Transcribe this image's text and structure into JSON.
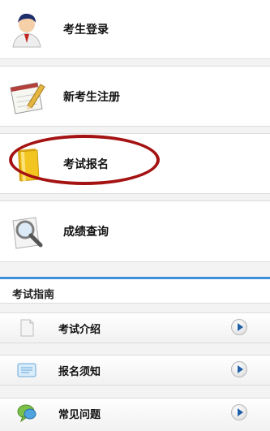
{
  "menu": {
    "items": [
      {
        "label": "考生登录",
        "icon": "user-avatar-icon"
      },
      {
        "label": "新考生注册",
        "icon": "notepad-pencil-icon"
      },
      {
        "label": "考试报名",
        "icon": "folder-icon"
      },
      {
        "label": "成绩查询",
        "icon": "magnifier-icon"
      }
    ]
  },
  "guide": {
    "title": "考试指南",
    "items": [
      {
        "label": "考试介绍",
        "icon": "document-icon"
      },
      {
        "label": "报名须知",
        "icon": "notice-icon"
      },
      {
        "label": "常见问题",
        "icon": "help-bubble-icon"
      }
    ]
  },
  "colors": {
    "accent": "#3f8fd8",
    "highlight": "#a41212"
  }
}
